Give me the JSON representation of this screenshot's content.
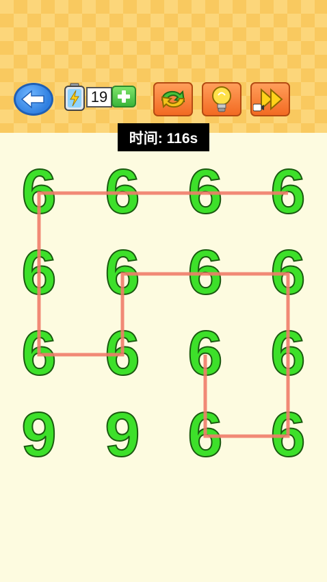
{
  "toolbar": {
    "back_icon": "arrow-left-icon",
    "energy_icon": "battery-lightning-icon",
    "energy_count": "19",
    "add_energy_icon": "plus-icon",
    "restart_icon": "restart-arrows-icon",
    "hint_icon": "lightbulb-icon",
    "skip_icon": "fast-forward-video-icon"
  },
  "timer": {
    "text": "时间: 116s"
  },
  "grid": {
    "rows": [
      [
        "6",
        "6",
        "6",
        "6"
      ],
      [
        "6",
        "6",
        "6",
        "6"
      ],
      [
        "6",
        "6",
        "6",
        "6"
      ],
      [
        "9",
        "9",
        "6",
        "6"
      ]
    ]
  },
  "colors": {
    "digit_fill": "#3de02a",
    "digit_outline": "#1a5a10",
    "path_line": "#f07c6a",
    "background": "#fdfbe0",
    "header": "#fcd67a"
  },
  "path_cells": [
    [
      0,
      3
    ],
    [
      0,
      2
    ],
    [
      0,
      1
    ],
    [
      0,
      0
    ],
    [
      1,
      0
    ],
    [
      2,
      0
    ],
    [
      2,
      1
    ],
    [
      1,
      1
    ],
    [
      1,
      2
    ],
    [
      1,
      3
    ],
    [
      2,
      3
    ],
    [
      3,
      3
    ],
    [
      3,
      2
    ],
    [
      2,
      2
    ]
  ]
}
